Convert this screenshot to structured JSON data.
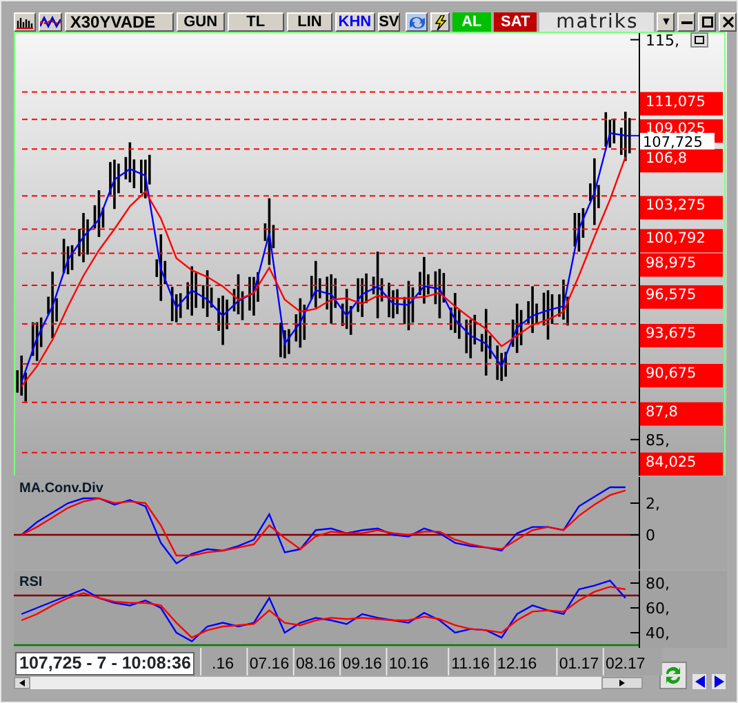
{
  "toolbar": {
    "symbol": "X30YVADE",
    "tabs": [
      {
        "label": "GUN",
        "selected": false
      },
      {
        "label": "TL",
        "selected": false
      },
      {
        "label": "LIN",
        "selected": false
      },
      {
        "label": "KHN",
        "selected": true
      },
      {
        "label": "SV",
        "selected": false
      }
    ],
    "buy_button": "AL",
    "sell_button": "SAT",
    "logo": "matriks",
    "menu_glyph": "▼"
  },
  "price_chart": {
    "chart_data": {
      "type": "line",
      "ylim": [
        82.3,
        115.6
      ],
      "yticks": [
        {
          "value": 115,
          "label": "115,"
        },
        {
          "value": 85,
          "label": "85,"
        }
      ],
      "series": [
        {
          "color": "#0000ff",
          "values": [
            89.3,
            92.6,
            95.0,
            98.5,
            100.2,
            101.5,
            104.5,
            105.3,
            104.8,
            97.8,
            94.9,
            96.2,
            95.5,
            94.3,
            95.4,
            96.0,
            100.5,
            92.2,
            93.8,
            96.2,
            95.9,
            94.3,
            95.9,
            96.5,
            95.2,
            95.1,
            96.5,
            96.3,
            94.0,
            92.8,
            92.2,
            90.5,
            93.4,
            94.3,
            94.7,
            95.0,
            100.8,
            103.5,
            108.0,
            107.8
          ]
        },
        {
          "color": "#ff0000",
          "values": [
            89.0,
            90.5,
            92.5,
            95.0,
            97.3,
            99.2,
            100.8,
            102.5,
            103.6,
            101.6,
            98.6,
            97.7,
            97.2,
            96.5,
            95.5,
            96.0,
            97.9,
            95.5,
            94.6,
            94.8,
            95.5,
            95.6,
            95.2,
            95.8,
            95.6,
            95.6,
            95.7,
            96.0,
            95.0,
            94.1,
            93.3,
            92.0,
            92.8,
            93.6,
            94.0,
            94.6,
            97.3,
            100.2,
            103.0,
            106.2
          ]
        }
      ],
      "ref_lines": [
        {
          "axis": "y",
          "value": 111.075,
          "label": "111,075",
          "color": "#ff0000"
        },
        {
          "axis": "y",
          "value": 109.025,
          "label": "109,025",
          "color": "#ff0000"
        },
        {
          "axis": "y",
          "value": 106.8,
          "label": "106,8",
          "color": "#ff0000"
        },
        {
          "axis": "y",
          "value": 103.275,
          "label": "103,275",
          "color": "#ff0000"
        },
        {
          "axis": "y",
          "value": 100.792,
          "label": "100,792",
          "color": "#ff0000"
        },
        {
          "axis": "y",
          "value": 98.975,
          "label": "98,975",
          "color": "#ff0000"
        },
        {
          "axis": "y",
          "value": 96.575,
          "label": "96,575",
          "color": "#ff0000"
        },
        {
          "axis": "y",
          "value": 93.675,
          "label": "93,675",
          "color": "#ff0000"
        },
        {
          "axis": "y",
          "value": 90.675,
          "label": "90,675",
          "color": "#ff0000"
        },
        {
          "axis": "y",
          "value": 87.8,
          "label": "87,8",
          "color": "#ff0000"
        },
        {
          "axis": "y",
          "value": 84.025,
          "label": "84,025",
          "color": "#ff0000"
        }
      ],
      "annotations": [
        "107,725"
      ]
    }
  },
  "macd_panel": {
    "title": "MA.Conv.Div",
    "chart_data": {
      "type": "line",
      "ylim": [
        -2.17,
        3.65
      ],
      "yticks": [
        {
          "value": 2,
          "label": "2,"
        },
        {
          "value": 0,
          "label": "0"
        }
      ],
      "series": [
        {
          "color": "#0000ff",
          "values": [
            0,
            0.8,
            1.4,
            2.0,
            2.3,
            2.3,
            1.9,
            2.2,
            1.8,
            -0.5,
            -1.8,
            -1.2,
            -0.9,
            -1.0,
            -0.7,
            -0.3,
            1.3,
            -1.1,
            -0.9,
            0.3,
            0.4,
            0.1,
            0.3,
            0.4,
            0.0,
            -0.1,
            0.4,
            0.1,
            -0.5,
            -0.7,
            -0.8,
            -1.0,
            0.1,
            0.5,
            0.5,
            0.3,
            1.8,
            2.4,
            3.0,
            3.0
          ]
        },
        {
          "color": "#ff0000",
          "values": [
            0,
            0.5,
            1.1,
            1.7,
            2.1,
            2.3,
            2.0,
            2.1,
            2.0,
            0.6,
            -1.3,
            -1.3,
            -1.1,
            -1.0,
            -0.8,
            -0.6,
            0.6,
            -0.2,
            -0.9,
            -0.1,
            0.2,
            0.1,
            0.1,
            0.3,
            0.1,
            0.0,
            0.2,
            0.2,
            -0.3,
            -0.6,
            -0.8,
            -0.9,
            -0.3,
            0.3,
            0.5,
            0.3,
            1.2,
            1.9,
            2.5,
            2.8
          ]
        }
      ],
      "ref_lines": [
        {
          "axis": "y",
          "value": 0,
          "color": "#800000"
        }
      ]
    }
  },
  "rsi_panel": {
    "title": "RSI",
    "chart_data": {
      "type": "line",
      "ylim": [
        27.8,
        90
      ],
      "categories": [
        null,
        null,
        null,
        null,
        null,
        null,
        null,
        null,
        null,
        null,
        null,
        null,
        null,
        ".16",
        null,
        null,
        "07.16",
        null,
        null,
        "08.16",
        null,
        null,
        "09.16",
        null,
        null,
        "10.16",
        null,
        null,
        null,
        "11.16",
        null,
        null,
        "12.16",
        null,
        null,
        null,
        "01.17",
        null,
        null,
        "02.17"
      ],
      "yticks": [
        {
          "value": 80,
          "label": "80,"
        },
        {
          "value": 60,
          "label": "60,"
        },
        {
          "value": 40,
          "label": "40,"
        }
      ],
      "series": [
        {
          "color": "#0000ff",
          "values": [
            55,
            60,
            65,
            70,
            75,
            68,
            64,
            62,
            66,
            60,
            40,
            33,
            45,
            48,
            45,
            48,
            68,
            40,
            48,
            52,
            50,
            47,
            55,
            52,
            50,
            48,
            56,
            50,
            40,
            43,
            42,
            36,
            55,
            62,
            58,
            55,
            75,
            78,
            82,
            68
          ]
        },
        {
          "color": "#ff0000",
          "values": [
            50,
            55,
            62,
            68,
            72,
            68,
            65,
            64,
            64,
            62,
            48,
            36,
            42,
            45,
            46,
            47,
            58,
            48,
            46,
            50,
            52,
            51,
            52,
            51,
            50,
            50,
            53,
            51,
            46,
            43,
            42,
            40,
            50,
            57,
            58,
            57,
            66,
            73,
            77,
            75
          ]
        }
      ],
      "ref_lines": [
        {
          "axis": "y",
          "value": 70,
          "color": "#800000"
        },
        {
          "axis": "y",
          "value": 30,
          "color": "#008000"
        }
      ]
    }
  },
  "status": "107,725 - 7 - 10:08:36"
}
